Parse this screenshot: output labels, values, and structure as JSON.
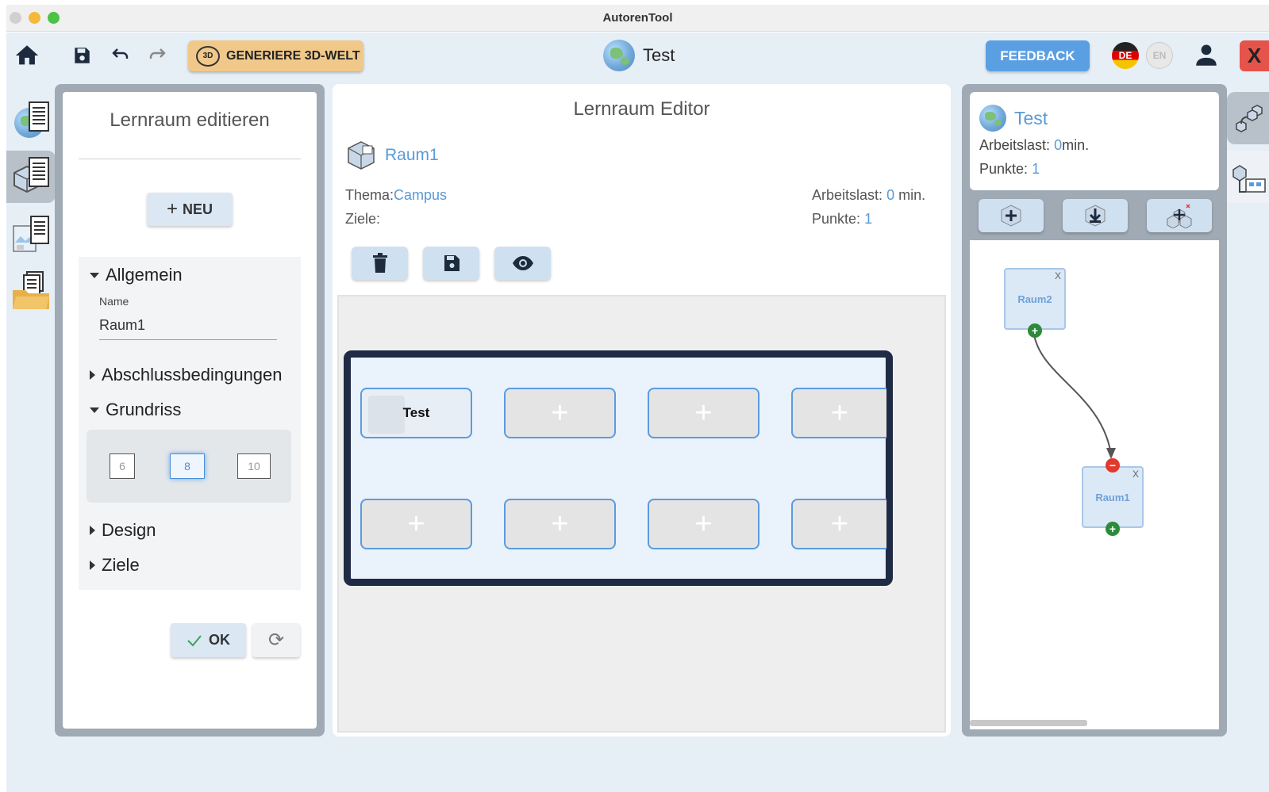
{
  "window": {
    "title": "AutorenTool"
  },
  "toolbar": {
    "generate_label": "GENERIERE 3D-WELT",
    "generate_icon_text": "3D",
    "world_title": "Test",
    "feedback_label": "FEEDBACK",
    "lang_de": "DE",
    "lang_en": "EN",
    "close_label": "X"
  },
  "left_panel": {
    "title": "Lernraum editieren",
    "new_button": "NEU",
    "sections": {
      "allgemein": "Allgemein",
      "abschluss": "Abschlussbedingungen",
      "grundriss": "Grundriss",
      "design": "Design",
      "ziele": "Ziele"
    },
    "name_label": "Name",
    "name_value": "Raum1",
    "floorplan_options": [
      "6",
      "8",
      "10"
    ],
    "floorplan_selected": "8",
    "ok_button": "OK"
  },
  "center_panel": {
    "title": "Lernraum Editor",
    "room_name": "Raum1",
    "thema_label": "Thema:",
    "thema_value": "Campus",
    "ziele_label": "Ziele:",
    "arbeitslast_label": "Arbeitslast:",
    "arbeitslast_value": "0",
    "arbeitslast_unit": "min.",
    "punkte_label": "Punkte:",
    "punkte_value": "1",
    "slots": [
      {
        "label": "Test",
        "filled": true
      },
      {
        "label": "+",
        "filled": false
      },
      {
        "label": "+",
        "filled": false
      },
      {
        "label": "+",
        "filled": false
      },
      {
        "label": "+",
        "filled": false
      },
      {
        "label": "+",
        "filled": false
      },
      {
        "label": "+",
        "filled": false
      },
      {
        "label": "+",
        "filled": false
      }
    ]
  },
  "right_panel": {
    "world_name": "Test",
    "arbeitslast_label": "Arbeitslast:",
    "arbeitslast_value": "0",
    "arbeitslast_unit": "min.",
    "punkte_label": "Punkte:",
    "punkte_value": "1",
    "nodes": {
      "raum2": {
        "label": "Raum2",
        "close": "X"
      },
      "raum1": {
        "label": "Raum1",
        "close": "X"
      }
    }
  },
  "colors": {
    "accent_blue": "#5a9ad6",
    "generate_button": "#f0c98a",
    "feedback_button": "#5b9fe3",
    "close_button": "#e5534b",
    "room_border": "#1f2b44"
  }
}
